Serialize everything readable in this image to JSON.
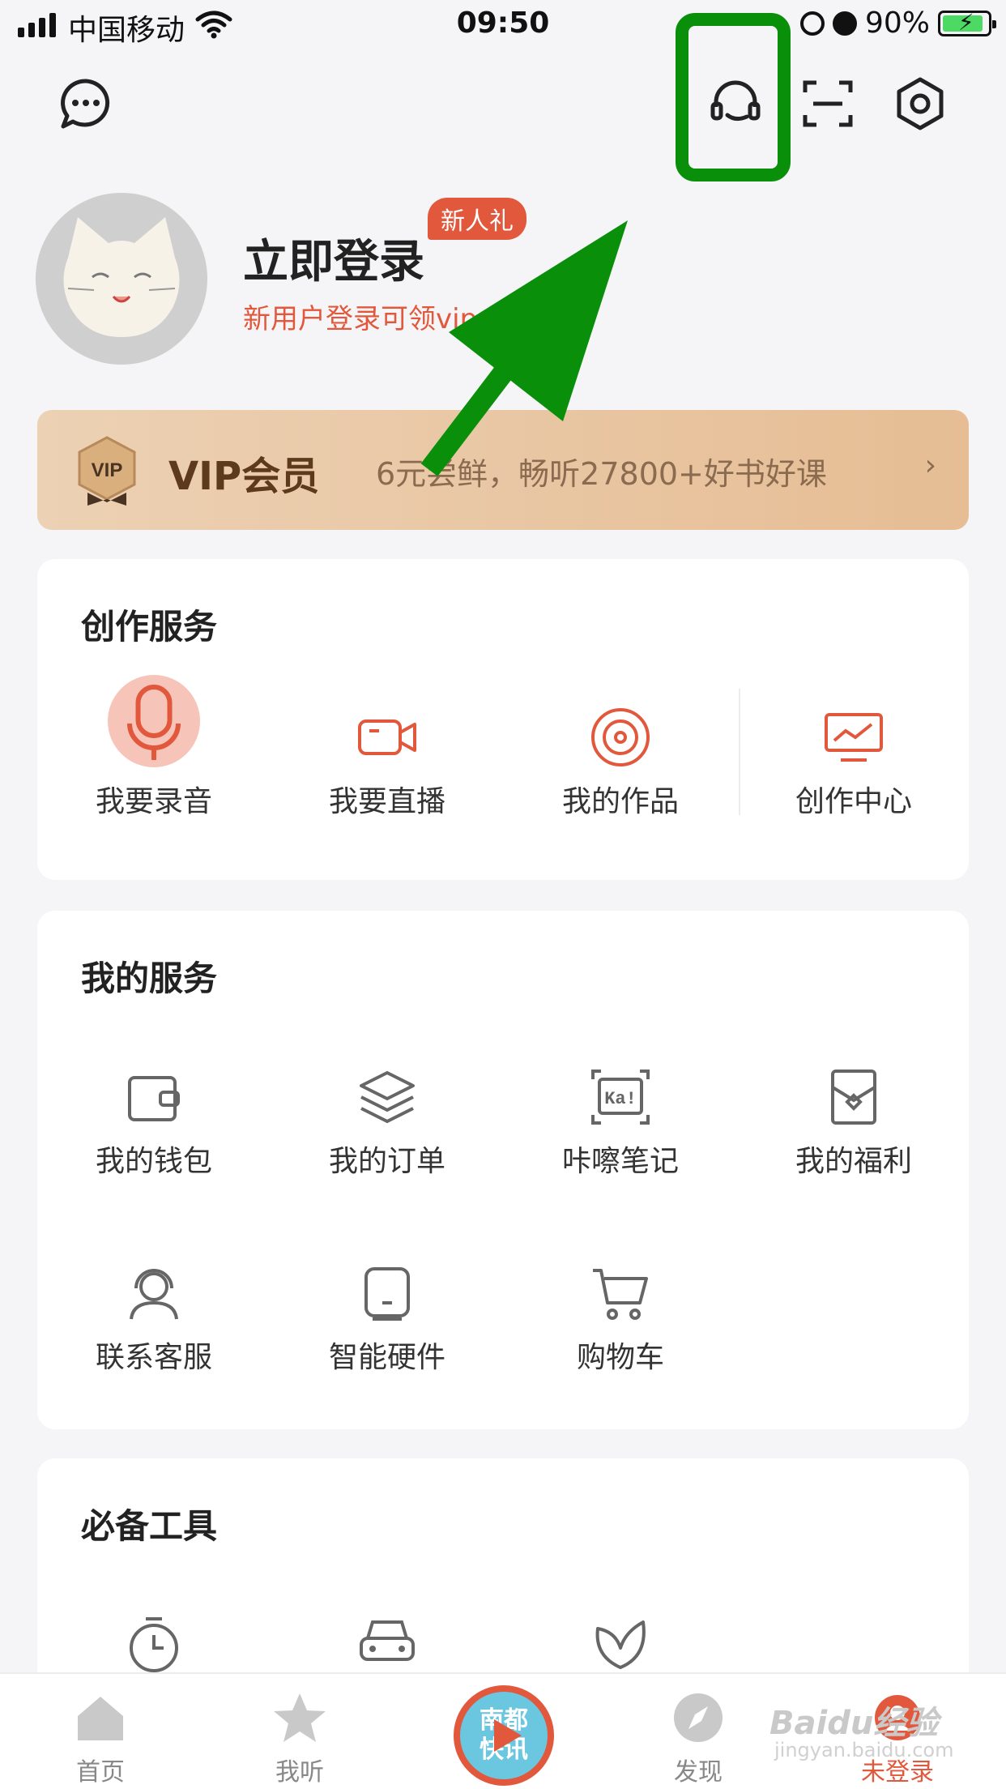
{
  "status_bar": {
    "carrier": "中国移动",
    "time": "09:50",
    "battery_percent": "90%"
  },
  "topbar": {
    "icons": [
      "message-icon",
      "customer-service-icon",
      "scan-icon",
      "settings-icon"
    ]
  },
  "profile": {
    "title": "立即登录",
    "badge": "新人礼",
    "subtitle": "新用户登录可领vip"
  },
  "vip": {
    "title": "VIP会员",
    "badge_text": "VIP",
    "description": "6元尝鲜，畅听27800+好书好课",
    "chevron": "›"
  },
  "creation_services": {
    "title": "创作服务",
    "items": [
      {
        "label": "我要录音",
        "icon": "microphone-icon"
      },
      {
        "label": "我要直播",
        "icon": "video-camera-icon"
      },
      {
        "label": "我的作品",
        "icon": "disc-icon"
      },
      {
        "label": "创作中心",
        "icon": "monitor-chart-icon"
      }
    ]
  },
  "my_services": {
    "title": "我的服务",
    "items": [
      {
        "label": "我的钱包",
        "icon": "wallet-icon"
      },
      {
        "label": "我的订单",
        "icon": "layers-icon"
      },
      {
        "label": "咔嚓笔记",
        "icon": "ka-notes-icon"
      },
      {
        "label": "我的福利",
        "icon": "gift-envelope-icon"
      },
      {
        "label": "联系客服",
        "icon": "support-agent-icon"
      },
      {
        "label": "智能硬件",
        "icon": "smart-speaker-icon"
      },
      {
        "label": "购物车",
        "icon": "cart-icon"
      }
    ],
    "ka_text": "Ka!"
  },
  "tools": {
    "title": "必备工具",
    "items": [
      {
        "icon": "timer-icon"
      },
      {
        "icon": "car-icon"
      },
      {
        "icon": "leaf-icon"
      }
    ]
  },
  "tabbar": {
    "tabs": [
      {
        "label": "首页",
        "icon": "home-icon"
      },
      {
        "label": "我听",
        "icon": "star-icon"
      },
      {
        "label": "",
        "icon": "play-center-icon"
      },
      {
        "label": "发现",
        "icon": "compass-icon"
      },
      {
        "label": "未登录",
        "icon": "profile-icon",
        "active": true
      }
    ],
    "center_text_line1": "南都",
    "center_text_line2": "快讯"
  },
  "watermark": {
    "text": "Baidu经验",
    "sub": "jingyan.baidu.com"
  },
  "colors": {
    "accent": "#e2583c",
    "highlight": "#0a8f0a",
    "vip_text": "#5e3a1c"
  }
}
